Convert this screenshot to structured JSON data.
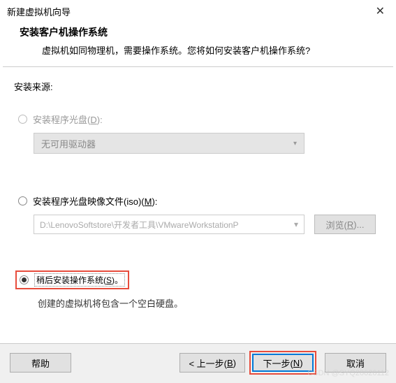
{
  "titlebar": {
    "title": "新建虚拟机向导"
  },
  "header": {
    "title": "安装客户机操作系统",
    "desc": "虚拟机如同物理机，需要操作系统。您将如何安装客户机操作系统?"
  },
  "source": {
    "label": "安装来源:"
  },
  "option_disc": {
    "label": "安装程序光盘(",
    "hotkey": "D",
    "suffix": "):",
    "dropdown": "无可用驱动器"
  },
  "option_iso": {
    "label": "安装程序光盘映像文件(iso)(",
    "hotkey": "M",
    "suffix": "):",
    "path": "D:\\LenovoSoftstore\\开发者工具\\VMwareWorkstationP",
    "browse": "浏览(",
    "browse_hotkey": "R",
    "browse_suffix": ")..."
  },
  "option_later": {
    "label": "稍后安装操作系统(",
    "hotkey": "S",
    "suffix": ")。",
    "desc": "创建的虚拟机将包含一个空白硬盘。"
  },
  "footer": {
    "help": "帮助",
    "back": "< 上一步(",
    "back_hotkey": "B",
    "back_suffix": ")",
    "next": "下一步(",
    "next_hotkey": "N",
    "next_suffix": ")",
    "cancel": "取消"
  },
  "watermark": "CSDN @SYQ20020112"
}
